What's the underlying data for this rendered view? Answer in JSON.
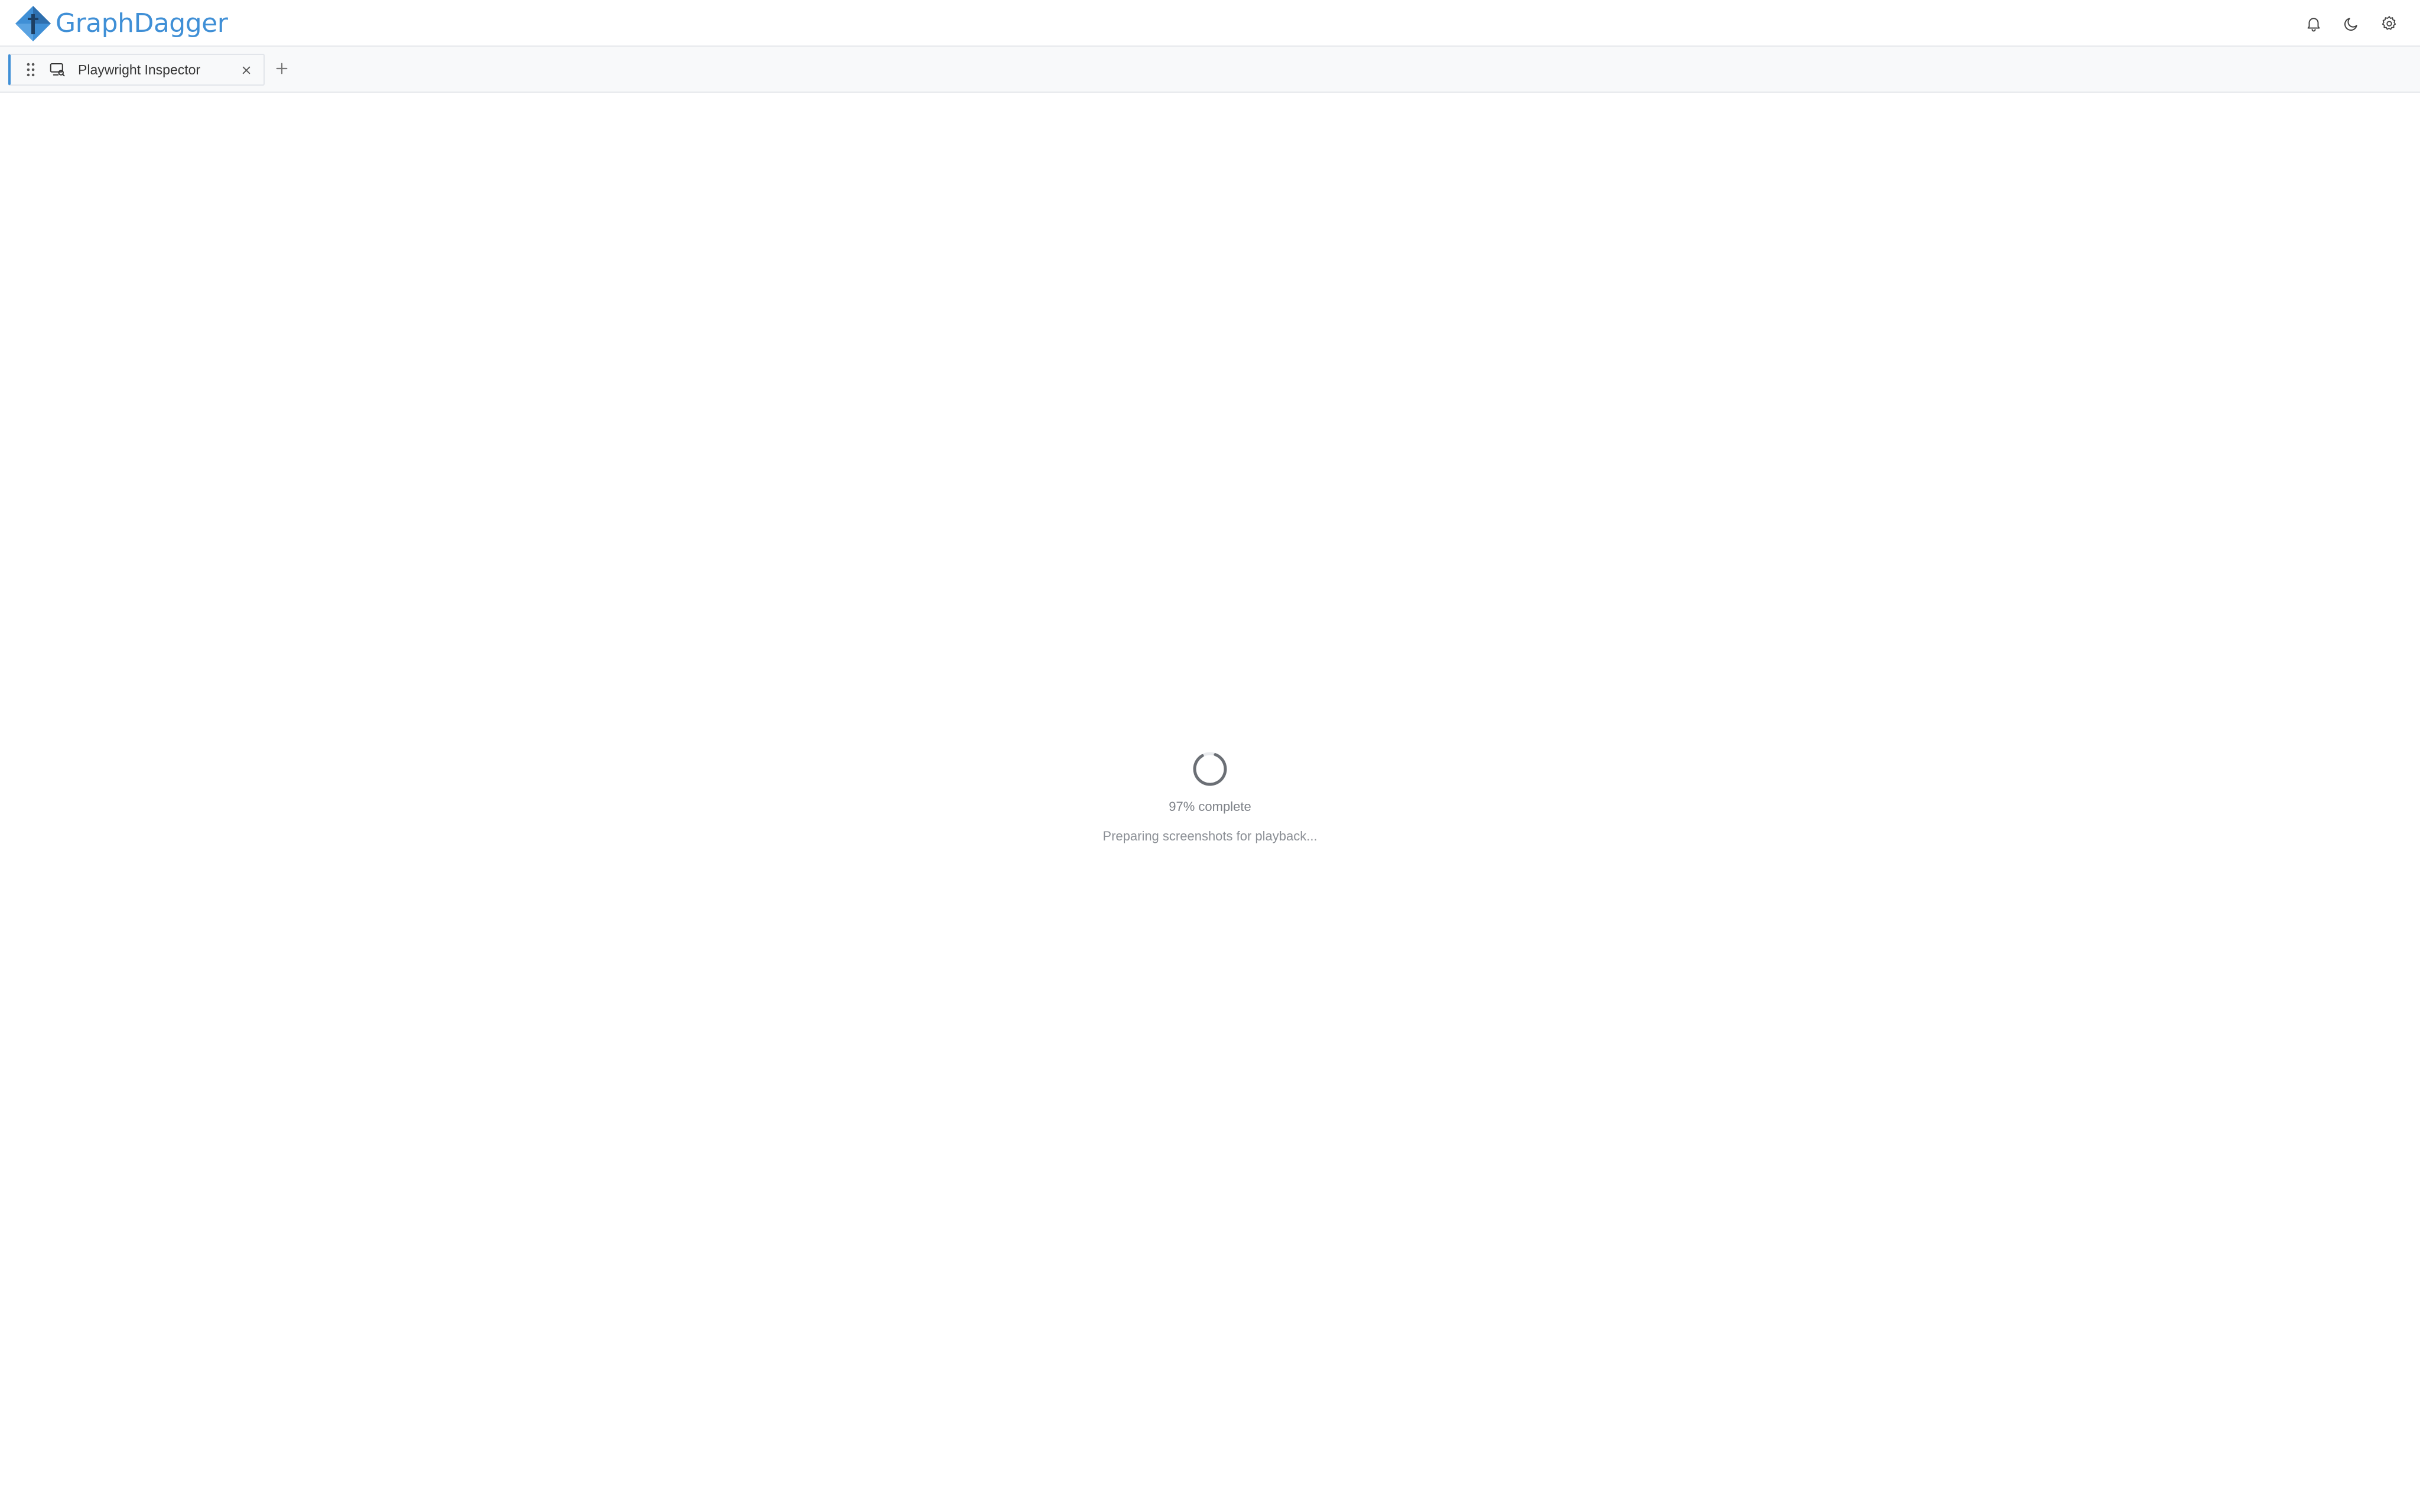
{
  "app": {
    "name": "GraphDagger",
    "brand_color": "#3f8fd6"
  },
  "header": {
    "actions": [
      {
        "icon": "bell-icon",
        "label": "Notifications"
      },
      {
        "icon": "moon-icon",
        "label": "Toggle theme"
      },
      {
        "icon": "gear-icon",
        "label": "Settings"
      }
    ]
  },
  "tabs": [
    {
      "label": "Playwright Inspector",
      "icon": "inspector-icon",
      "active": true
    }
  ],
  "loading": {
    "progress_percent": 97,
    "progress_text": "97% complete",
    "status_text": "Preparing screenshots for playback..."
  }
}
